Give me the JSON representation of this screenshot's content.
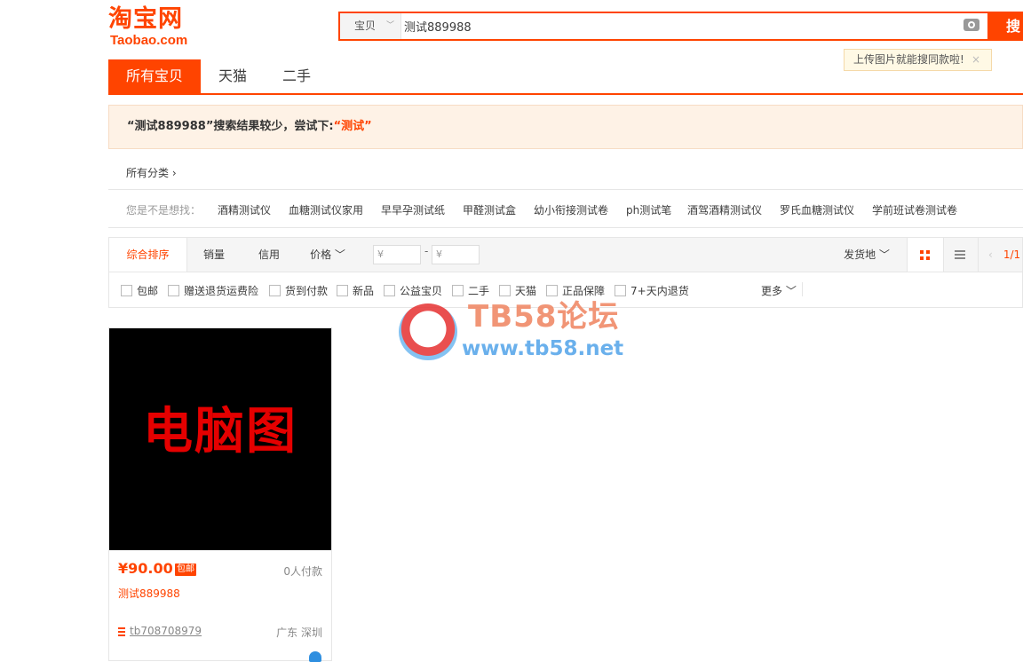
{
  "logo": {
    "cn": "淘宝网",
    "en": "Taobao.com"
  },
  "search": {
    "scope": "宝贝",
    "query": "测试889988",
    "button": "搜",
    "image_tip": "上传图片就能搜同款啦!",
    "tip_close": "×"
  },
  "tabs": [
    "所有宝贝",
    "天猫",
    "二手"
  ],
  "notice": {
    "prefix": "“测试889988”搜索结果较少，尝试下:",
    "suggestion": "“测试”"
  },
  "breadcrumb": "所有分类",
  "related": {
    "lead": "您是不是想找：",
    "items": [
      "酒精测试仪",
      "血糖测试仪家用",
      "早早孕测试纸",
      "甲醛测试盒",
      "幼小衔接测试卷",
      "ph测试笔",
      "酒驾酒精测试仪",
      "罗氏血糖测试仪",
      "学前班试卷测试卷"
    ]
  },
  "sort": {
    "options": [
      "综合排序",
      "销量",
      "信用",
      "价格"
    ],
    "price_min_placeholder": "¥",
    "price_max_placeholder": "¥",
    "ship_from": "发货地",
    "page": "1/1"
  },
  "filters": [
    "包邮",
    "赠送退货运费险",
    "货到付款",
    "新品",
    "公益宝贝",
    "二手",
    "天猫",
    "正品保障",
    "7+天内退货"
  ],
  "more": "更多",
  "watermark": {
    "title": "TB58论坛",
    "url": "www.tb58.net"
  },
  "product": {
    "image_text": "电脑图",
    "price": "¥90.00",
    "badge": "包邮",
    "sales": "0人付款",
    "title": "测试889988",
    "shop": "tb708708979",
    "location": "广东 深圳"
  },
  "colors": {
    "accent": "#ff4400",
    "notice_bg": "#fef2e6"
  }
}
